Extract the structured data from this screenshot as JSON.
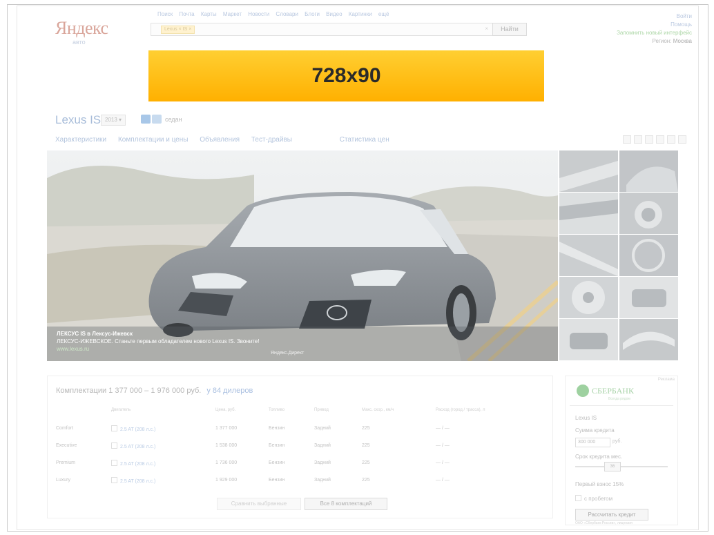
{
  "header": {
    "logo": "Яндекс",
    "logo_sub": "авто",
    "services": [
      "Поиск",
      "Почта",
      "Карты",
      "Маркет",
      "Новости",
      "Словари",
      "Блоги",
      "Видео",
      "Картинки",
      "ещё"
    ],
    "search_chip": "Lexus × IS ×",
    "search_clear": "×",
    "find_button": "Найти",
    "login": "Войти",
    "help": "Помощь",
    "remember": "Запомнить новый интерфейс",
    "region_label": "Регион:",
    "region": "Москва"
  },
  "banner": {
    "text": "728x90"
  },
  "model": {
    "name": "Lexus IS",
    "year": "2013 ▾",
    "body_type": "седан"
  },
  "tabs": [
    "Характеристики",
    "Комплектации и цены",
    "Объявления",
    "Тест-драйвы",
    "Статистика цен"
  ],
  "gallery": {
    "caption_title": "ЛЕКСУС IS в Лексус-Ижевск",
    "caption_text": "ЛЕКСУС-ИЖЕВСКОЕ. Станьте первым обладателем нового Lexus IS. Звоните!",
    "caption_link": "www.lexus.ru",
    "caption_source": "Яндекс.Директ"
  },
  "configs": {
    "title": "Комплектации 1 377 000 – 1 976 000 руб.",
    "dealers_link": "у 84 дилеров",
    "headers": [
      "Двигатель",
      "Цена, руб.",
      "Топливо",
      "Привод",
      "Макс. скор., км/ч",
      "Расход (город / трасса), л"
    ],
    "rows": [
      {
        "name": "Comfort",
        "engine": "2.5 AT (208 л.с.)",
        "price": "1 377 000",
        "fuel": "Бензин",
        "drive": "Задний",
        "speed": "225",
        "consumption": "— / —"
      },
      {
        "name": "Executive",
        "engine": "2.5 AT (208 л.с.)",
        "price": "1 538 000",
        "fuel": "Бензин",
        "drive": "Задний",
        "speed": "225",
        "consumption": "— / —"
      },
      {
        "name": "Premium",
        "engine": "2.5 AT (208 л.с.)",
        "price": "1 736 000",
        "fuel": "Бензин",
        "drive": "Задний",
        "speed": "225",
        "consumption": "— / —"
      },
      {
        "name": "Luxury",
        "engine": "2.5 AT (208 л.с.)",
        "price": "1 929 000",
        "fuel": "Бензин",
        "drive": "Задний",
        "speed": "225",
        "consumption": "— / —"
      }
    ],
    "compare_button": "Сравнить выбранные",
    "all_button": "Все 8 комплектаций"
  },
  "sberbank": {
    "ad_label": "Реклама",
    "name": "СБЕРБАНК",
    "tagline": "Всегда рядом",
    "model": "Lexus IS",
    "credit_label": "Сумма кредита",
    "credit_value": "300 000",
    "currency": "руб.",
    "term_label": "Срок кредита мес.",
    "term_value": "36",
    "down_payment": "Первый взнос 15%",
    "mileage_check": "с пробегом",
    "calc_button": "Рассчитать кредит",
    "footnote": "ОАО «Сбербанк России», лицензия"
  }
}
